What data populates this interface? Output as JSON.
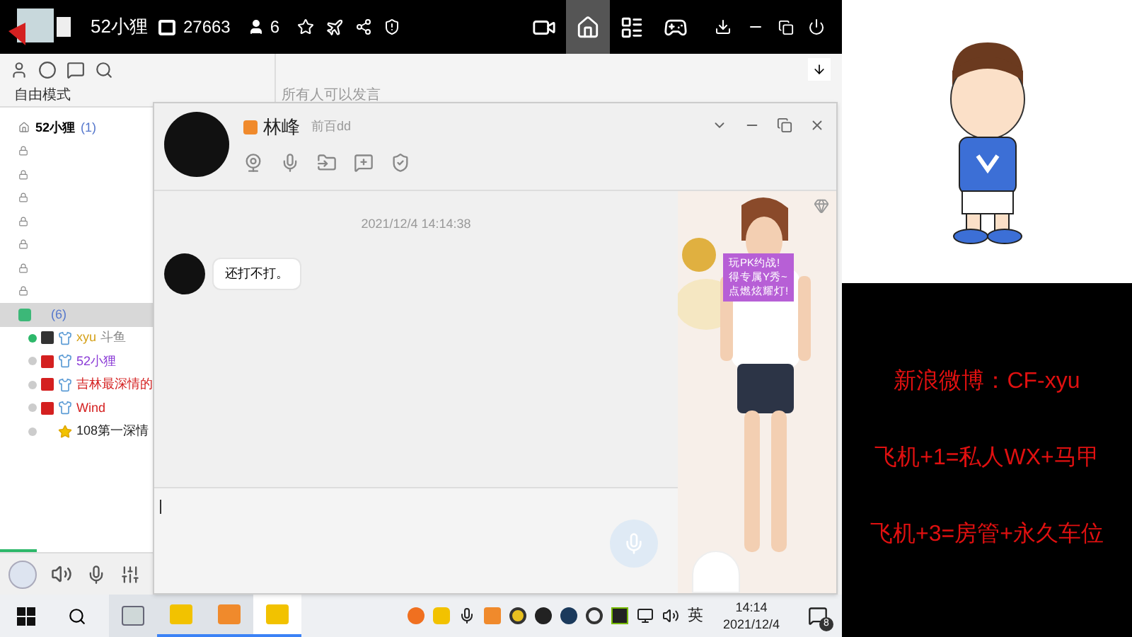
{
  "top_bar": {
    "room_name": "52小狸",
    "room_id": "27663",
    "viewers": "6",
    "nav": [
      {
        "kind": "video",
        "selected": false
      },
      {
        "kind": "home",
        "selected": true
      },
      {
        "kind": "list",
        "selected": false
      },
      {
        "kind": "game",
        "selected": false
      }
    ]
  },
  "sidebar": {
    "mode": "自由模式",
    "channels": [
      {
        "kind": "home",
        "label": "52小狸",
        "count": "(1)",
        "selected": false
      },
      {
        "kind": "lock",
        "selected": false
      },
      {
        "kind": "lock",
        "selected": false
      },
      {
        "kind": "lock",
        "selected": false
      },
      {
        "kind": "lock",
        "selected": false
      },
      {
        "kind": "lock",
        "selected": false
      },
      {
        "kind": "lock",
        "selected": false
      },
      {
        "kind": "lock",
        "selected": false
      },
      {
        "kind": "group",
        "count": "(6)",
        "selected": true
      }
    ],
    "members": [
      {
        "name": "xyu",
        "extra": "斗鱼",
        "online": true,
        "color": "#d4a017",
        "kind": "gold"
      },
      {
        "name": "52小狸",
        "online": false,
        "color": "#8a3ad6",
        "kind": "vip"
      },
      {
        "name": "吉林最深情的",
        "online": false,
        "color": "#d42020",
        "kind": "vip"
      },
      {
        "name": "Wind",
        "online": false,
        "color": "#d42020",
        "kind": "vip"
      },
      {
        "name": "108第一深情",
        "online": false,
        "color": "#222222",
        "kind": "plain"
      }
    ]
  },
  "main": {
    "notice": "所有人可以发言"
  },
  "chat_window": {
    "name": "林峰",
    "signature": "前百dd",
    "timestamp": "2021/12/4 14:14:38",
    "messages": [
      {
        "text": "还打不打。"
      }
    ],
    "promo": [
      "玩PK约战!",
      "得专属Y秀~",
      "点燃炫耀灯!"
    ]
  },
  "overlay": {
    "lines": [
      "新浪微博：CF-xyu",
      "飞机+1=私人WX+马甲",
      "飞机+3=房管+永久车位"
    ]
  },
  "taskbar": {
    "apps": [
      {
        "kind": "window",
        "selected": false
      },
      {
        "kind": "raccoon",
        "selected": false
      },
      {
        "kind": "orange",
        "selected": false
      },
      {
        "kind": "raccoon",
        "selected": true
      }
    ],
    "language": "英",
    "time": "14:14",
    "date": "2021/12/4",
    "notifications": "8"
  }
}
